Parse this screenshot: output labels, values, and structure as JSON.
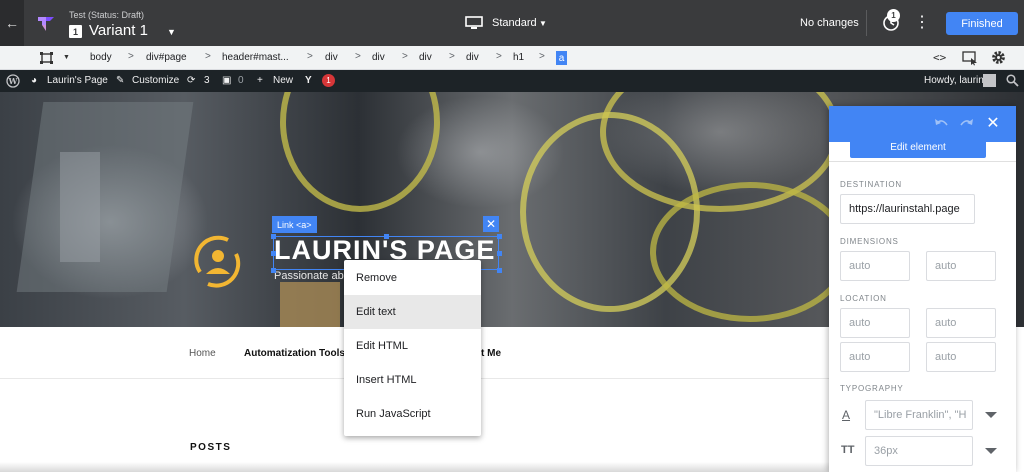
{
  "topbar": {
    "test_status": "Test (Status: Draft)",
    "variant_number": "1",
    "variant_name": "Variant 1",
    "device_label": "Standard",
    "change_status": "No changes",
    "history_count": "1",
    "finished_label": "Finished",
    "accent_color": "#4285f4"
  },
  "breadcrumb": {
    "items": [
      "body",
      "div#page",
      "header#mast...",
      "div",
      "div",
      "div",
      "div",
      "h1"
    ],
    "active": "a",
    "separator": ">"
  },
  "wp_admin_bar": {
    "site_name": "Laurin's Page",
    "customize": "Customize",
    "updates_count": "3",
    "comments_count": "0",
    "new_label": "New",
    "yoast_count": "1",
    "greeting": "Howdy, laurin"
  },
  "hero": {
    "selected_tag": "Link <a>",
    "site_title": "LAURIN'S PAGE",
    "tagline": "Passionate ab"
  },
  "context_menu": {
    "items": [
      "Remove",
      "Edit text",
      "Edit HTML",
      "Insert HTML",
      "Run JavaScript"
    ]
  },
  "nav": {
    "items": [
      "Home",
      "Automatization Tools",
      "t Me"
    ]
  },
  "posts_heading": "POSTS",
  "panel": {
    "tab_label": "Edit element",
    "destination_label": "DESTINATION",
    "destination_value": "https://laurinstahl.page",
    "dimensions_label": "DIMENSIONS",
    "width_placeholder": "auto",
    "height_placeholder": "auto",
    "location_label": "LOCATION",
    "top_placeholder": "auto",
    "right_placeholder": "auto",
    "bottom_placeholder": "auto",
    "left_placeholder": "auto",
    "typography_label": "TYPOGRAPHY",
    "font_family": "\"Libre Franklin\", \"H",
    "font_size": "36px"
  }
}
